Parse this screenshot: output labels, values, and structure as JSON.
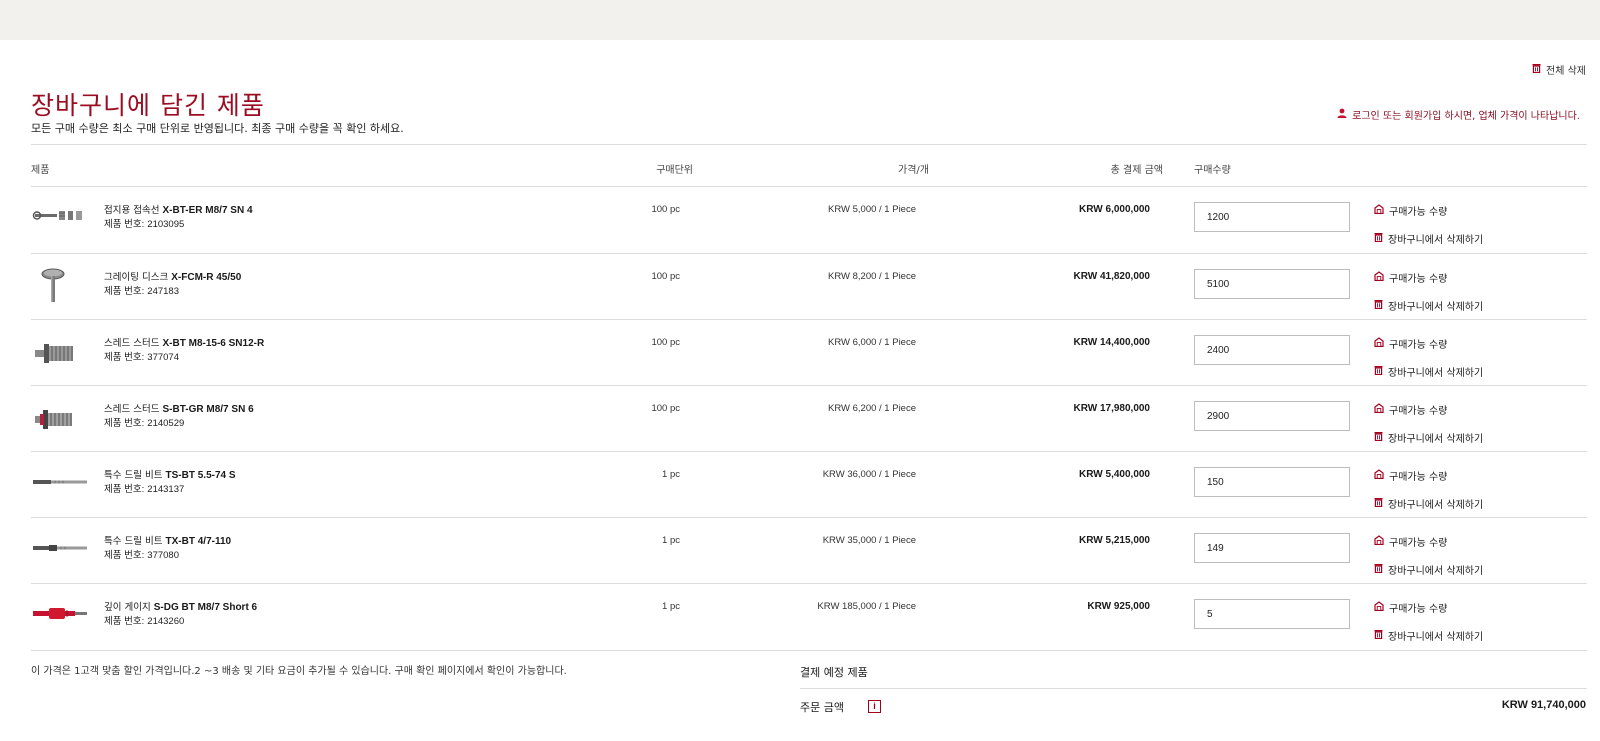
{
  "header": {
    "delete_all_label": "전체 삭제",
    "title": "장바구니에 담긴 제품",
    "subtitle": "모든 구매 수량은 최소 구매 단위로 반영됩니다. 최종 구매 수량을 꼭 확인 하세요.",
    "login_note": "로그인 또는 회원가입 하시면, 업체 가격이 나타납니다."
  },
  "columns": {
    "product": "제품",
    "unit": "구매단위",
    "price": "가격/개",
    "total": "총 결제 금액",
    "qty": "구매수량"
  },
  "item_labels": {
    "product_number_prefix": "제품 번호:",
    "available_qty": "구매가능 수량",
    "remove": "장바구니에서 삭제하기"
  },
  "items": [
    {
      "name_ko": "접지용 접속선",
      "name_code": "X-BT-ER M8/7 SN 4",
      "product_number": "2103095",
      "unit": "100 pc",
      "price": "KRW 5,000 / 1 Piece",
      "total": "KRW 6,000,000",
      "qty": "1200",
      "icon": "ground-connector-icon"
    },
    {
      "name_ko": "그레이팅 디스크",
      "name_code": "X-FCM-R 45/50",
      "product_number": "247183",
      "unit": "100 pc",
      "price": "KRW 8,200 / 1 Piece",
      "total": "KRW 41,820,000",
      "qty": "5100",
      "icon": "grating-disc-icon"
    },
    {
      "name_ko": "스레드 스터드",
      "name_code": "X-BT M8-15-6 SN12-R",
      "product_number": "377074",
      "unit": "100 pc",
      "price": "KRW 6,000 / 1 Piece",
      "total": "KRW 14,400,000",
      "qty": "2400",
      "icon": "threaded-stud-icon"
    },
    {
      "name_ko": "스레드 스터드",
      "name_code": "S-BT-GR M8/7 SN 6",
      "product_number": "2140529",
      "unit": "100 pc",
      "price": "KRW 6,200 / 1 Piece",
      "total": "KRW 17,980,000",
      "qty": "2900",
      "icon": "threaded-stud-red-icon"
    },
    {
      "name_ko": "특수 드릴 비트",
      "name_code": "TS-BT 5.5-74 S",
      "product_number": "2143137",
      "unit": "1 pc",
      "price": "KRW 36,000 / 1 Piece",
      "total": "KRW 5,400,000",
      "qty": "150",
      "icon": "drill-bit-icon"
    },
    {
      "name_ko": "특수 드릴 비트",
      "name_code": "TX-BT 4/7-110",
      "product_number": "377080",
      "unit": "1 pc",
      "price": "KRW 35,000 / 1 Piece",
      "total": "KRW 5,215,000",
      "qty": "149",
      "icon": "drill-bit-stepped-icon"
    },
    {
      "name_ko": "깊이 게이지",
      "name_code": "S-DG BT M8/7 Short 6",
      "product_number": "2143260",
      "unit": "1 pc",
      "price": "KRW 185,000 / 1 Piece",
      "total": "KRW 925,000",
      "qty": "5",
      "icon": "depth-gauge-icon"
    }
  ],
  "footer": {
    "note": "이 가격은 1고객 맞춤 할인 가격입니다.2 ~3 배송 및 기타 요금이 추가될 수 있습니다. 구매 확인 페이지에서 확인이 가능합니다.",
    "summary_title": "결제 예정 제품",
    "order_label": "주문 금액",
    "order_total": "KRW 91,740,000",
    "info_icon": "i"
  },
  "colors": {
    "accent": "#9b0d22",
    "icon_red": "#a3001e",
    "top_band": "#f3f1ee",
    "divider": "#dddddd"
  }
}
